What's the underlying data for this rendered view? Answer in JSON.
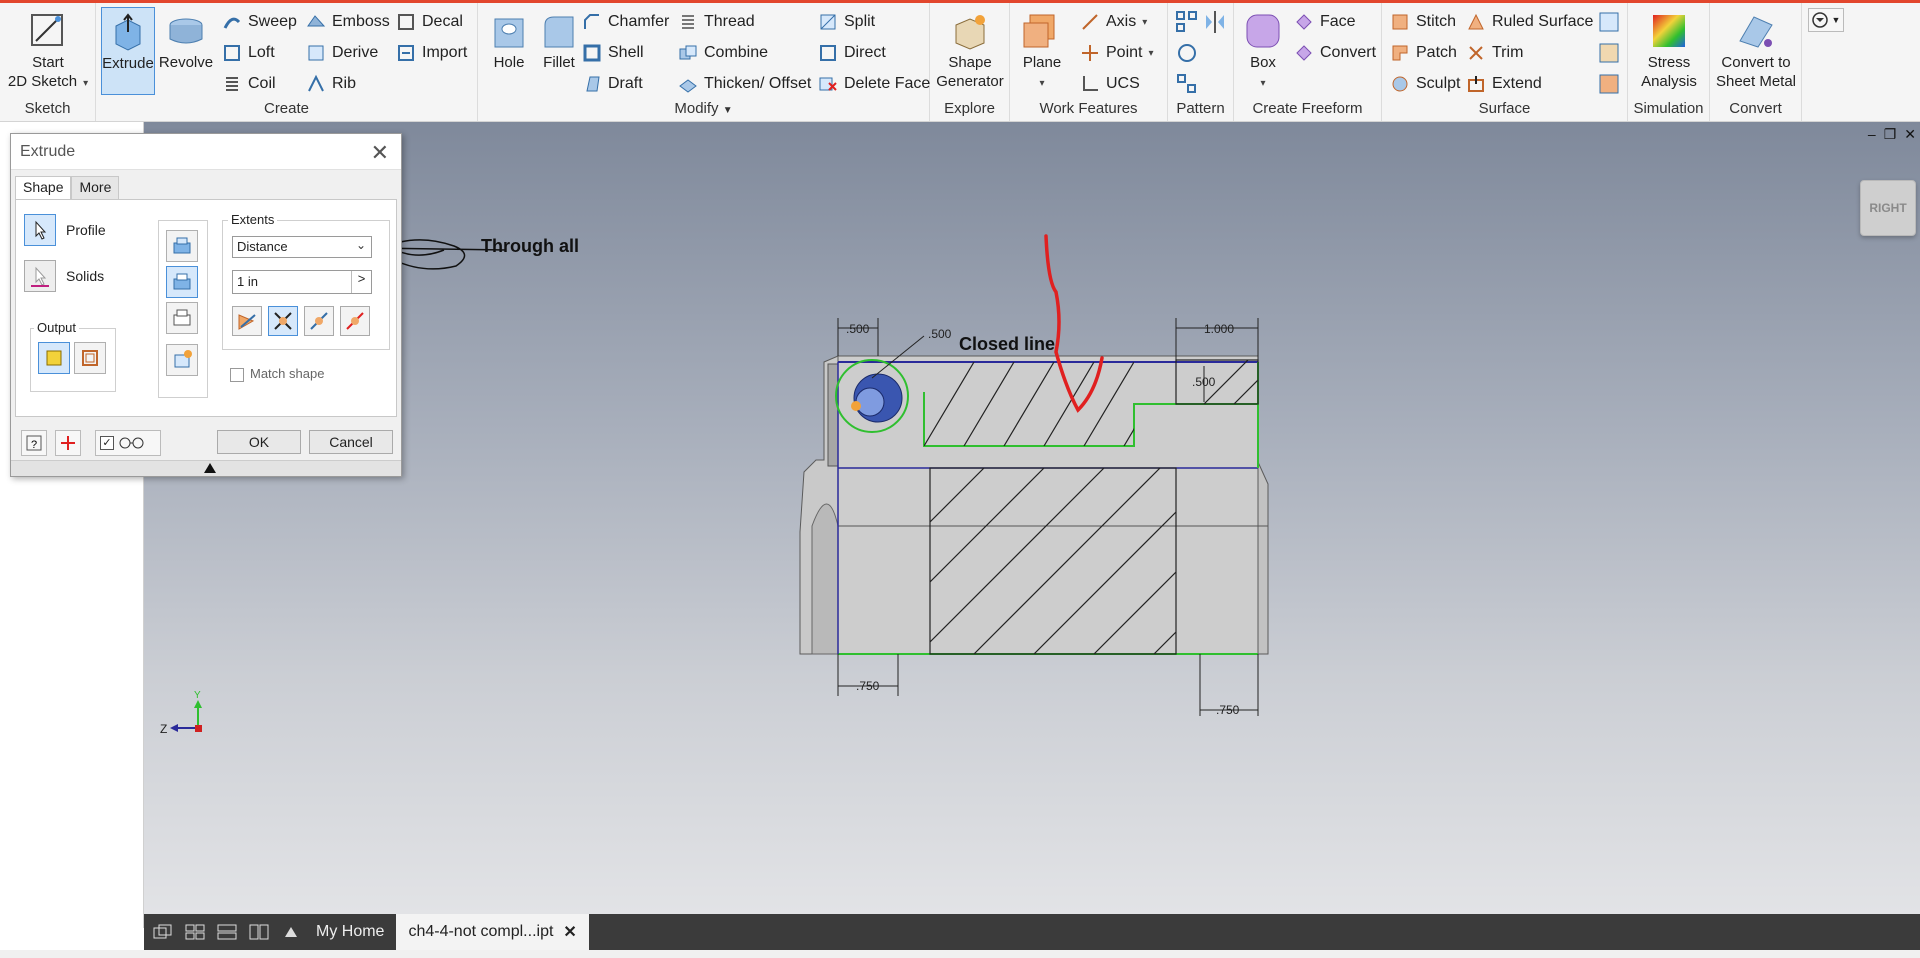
{
  "ribbon": {
    "sketch": {
      "start_label": "Start",
      "start_label2": "2D Sketch",
      "group": "Sketch"
    },
    "create": {
      "group": "Create",
      "extrude": "Extrude",
      "revolve": "Revolve",
      "sweep": "Sweep",
      "loft": "Loft",
      "coil": "Coil",
      "emboss": "Emboss",
      "derive": "Derive",
      "rib": "Rib",
      "decal": "Decal",
      "import": "Import"
    },
    "modify": {
      "group": "Modify",
      "hole": "Hole",
      "fillet": "Fillet",
      "chamfer": "Chamfer",
      "shell": "Shell",
      "draft": "Draft",
      "thread": "Thread",
      "combine": "Combine",
      "thicken": "Thicken/ Offset",
      "split": "Split",
      "direct": "Direct",
      "delete_face": "Delete Face"
    },
    "explore": {
      "group": "Explore",
      "shape_gen": "Shape",
      "shape_gen2": "Generator"
    },
    "work": {
      "group": "Work Features",
      "plane": "Plane",
      "axis": "Axis",
      "point": "Point",
      "ucs": "UCS"
    },
    "pattern": {
      "group": "Pattern"
    },
    "freeform": {
      "group": "Create Freeform",
      "box": "Box",
      "face": "Face",
      "convert": "Convert"
    },
    "surface": {
      "group": "Surface",
      "stitch": "Stitch",
      "patch": "Patch",
      "sculpt": "Sculpt",
      "ruled": "Ruled Surface",
      "trim": "Trim",
      "extend": "Extend"
    },
    "simulation": {
      "group": "Simulation",
      "stress": "Stress",
      "stress2": "Analysis"
    },
    "convert": {
      "group": "Convert",
      "sheet": "Convert to",
      "sheet2": "Sheet Metal"
    }
  },
  "dialog": {
    "title": "Extrude",
    "tabs": [
      {
        "label": "Shape"
      },
      {
        "label": "More"
      }
    ],
    "profile_label": "Profile",
    "solids_label": "Solids",
    "output_legend": "Output",
    "extents_legend": "Extents",
    "extents_value": "Distance",
    "distance_value": "1 in",
    "match_shape": "Match shape",
    "ok": "OK",
    "cancel": "Cancel"
  },
  "annotations": {
    "through_all": "Through all",
    "closed_line": "Closed line"
  },
  "drawing": {
    "dim_top_left": ".500",
    "dim_top_center": ".500",
    "dim_top_right": "1.000",
    "dim_right_notch": ".500",
    "dim_bottom_left": ".750",
    "dim_bottom_right": ".750"
  },
  "viewcube": {
    "label": "RIGHT"
  },
  "triad": {
    "z": "Z",
    "y": "Y"
  },
  "docbar": {
    "home": "My Home",
    "doc": "ch4-4-not compl...ipt"
  },
  "colors": {
    "accent": "#4a90d9",
    "brand": "#e2462d",
    "sketch_green": "#2fbf2f",
    "markup_red": "#e02020"
  }
}
